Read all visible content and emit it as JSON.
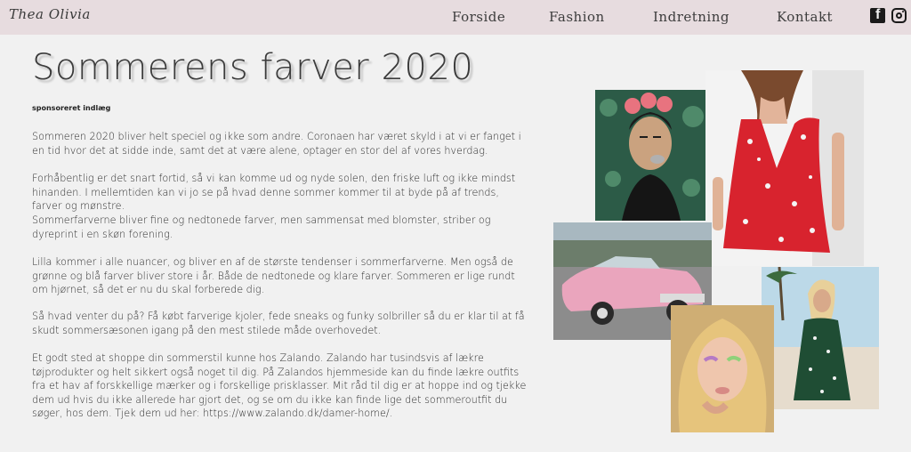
{
  "site": {
    "logo": "Thea Olivia"
  },
  "nav": {
    "items": [
      "Forside",
      "Fashion",
      "Indretning",
      "Kontakt"
    ]
  },
  "social": {
    "facebook_icon": "facebook-icon",
    "instagram_icon": "instagram-icon"
  },
  "article": {
    "title": "Sommerens farver 2020",
    "sponsored": "sponsoreret indlæg",
    "paragraphs": [
      "Sommeren 2020 bliver helt speciel og ikke som andre. Coronaen har været skyld i at vi er fanget i en tid hvor det at sidde inde, samt det at være alene, optager en stor del af vores hverdag.",
      "Forhåbentlig er det snart fortid, så vi kan komme ud og nyde solen, den friske luft og ikke mindst hinanden. I mellemtiden kan vi jo se på hvad denne sommer kommer til at byde på af trends, farver og mønstre.",
      "Sommerfarverne bliver fine og nedtonede farver, men sammensat med blomster, striber og dyreprint i en skøn forening.",
      "Lilla kommer i alle nuancer, og bliver en af de største tendenser i sommerfarverne. Men også de grønne og blå farver bliver store i år. Både de nedtonede og klare farver. Sommeren er lige rundt om hjørnet, så det er nu du skal forberede dig.",
      "Så hvad venter du på? Få købt farverige kjoler, fede sneaks og funky solbriller så du er klar til at få skudt sommersæsonen igang på den mest stilede måde overhovedet.",
      "Et godt sted at shoppe din sommerstil kunne hos Zalando. Zalando har tusindsvis af lækre tøjprodukter og helt sikkert også noget til dig. På Zalandos hjemmeside kan du finde lækre outfits fra et hav af forskkellige mærker og i forskellige prisklasser. Mit råd til dig er at hoppe ind og tjekke dem ud hvis du ikke allerede har gjort det, og se om du ikke kan finde lige det sommeroutfit du søger, hos dem. Tjek dem ud her: https://www.zalando.dk/damer-home/."
    ]
  },
  "colors": {
    "header_bg": "#e7dcdf",
    "page_bg": "#f1f1f1",
    "text": "#2f2f2f"
  }
}
